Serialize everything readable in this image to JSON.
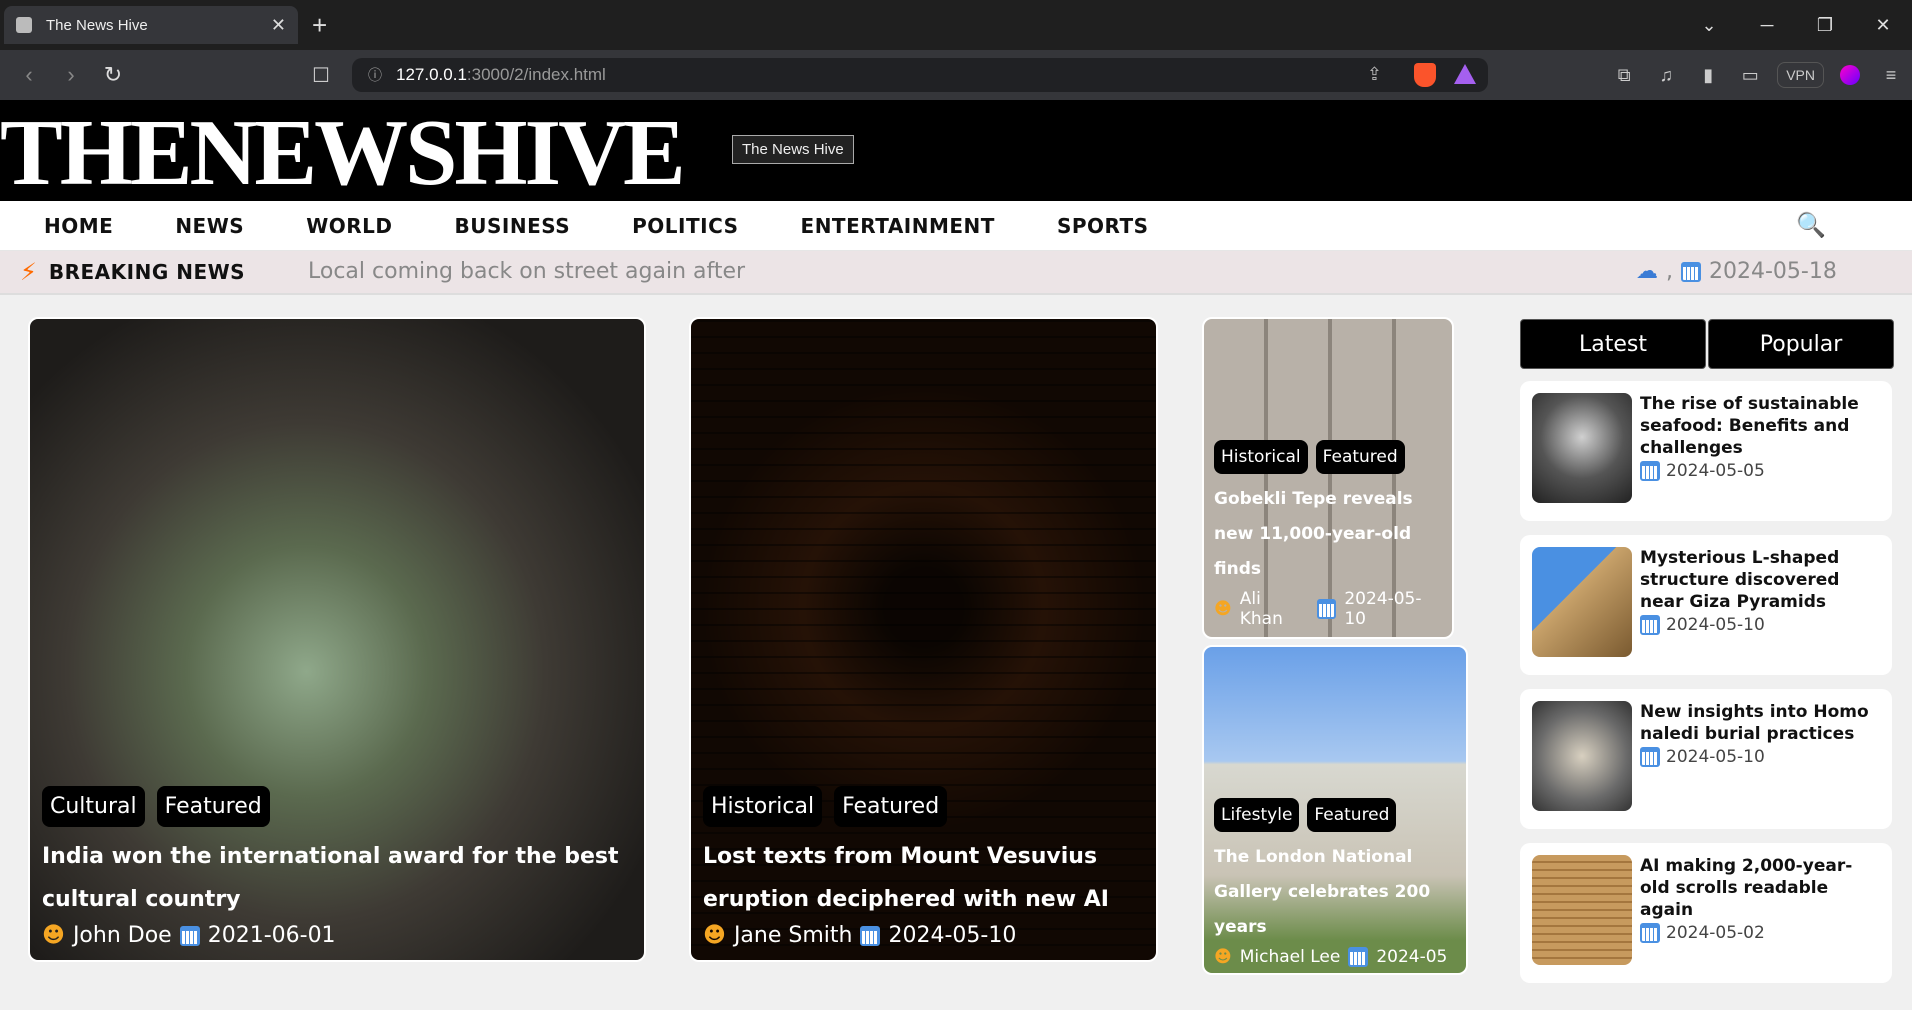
{
  "browser": {
    "tab_title": "The News Hive",
    "url_host": "127.0.0.1",
    "url_path": ":3000/2/index.html",
    "vpn_label": "VPN"
  },
  "site": {
    "logo_text": "THENEWSHIVE",
    "header_badge": "The News Hive"
  },
  "nav": {
    "items": [
      "HOME",
      "NEWS",
      "WORLD",
      "BUSINESS",
      "POLITICS",
      "ENTERTAINMENT",
      "SPORTS"
    ]
  },
  "breaking": {
    "label": "BREAKING NEWS",
    "ticker": "Local coming back on street again after",
    "weather_sep": ",",
    "date": "2024-05-18"
  },
  "featured": [
    {
      "tags": [
        "Cultural",
        "Featured"
      ],
      "title": "India won the international award for the best cultural country",
      "author": "John Doe",
      "date": "2021-06-01"
    },
    {
      "tags": [
        "Historical",
        "Featured"
      ],
      "title": "Lost texts from Mount Vesuvius eruption deciphered with new AI",
      "author": "Jane Smith",
      "date": "2024-05-10"
    },
    {
      "tags": [
        "Historical",
        "Featured"
      ],
      "title": "Gobekli Tepe reveals new 11,000-year-old finds",
      "author": "Ali Khan",
      "date": "2024-05-10"
    },
    {
      "tags": [
        "Lifestyle",
        "Featured"
      ],
      "title": "The London National Gallery celebrates 200 years",
      "author": "Michael Lee",
      "date": "2024-05"
    }
  ],
  "sidebar": {
    "tabs": [
      "Latest",
      "Popular"
    ],
    "items": [
      {
        "title": "The rise of sustainable seafood: Benefits and challenges",
        "date": "2024-05-05"
      },
      {
        "title": "Mysterious L-shaped structure discovered near Giza Pyramids",
        "date": "2024-05-10"
      },
      {
        "title": "New insights into Homo naledi burial practices",
        "date": "2024-05-10"
      },
      {
        "title": "AI making 2,000-year-old scrolls readable again",
        "date": "2024-05-02"
      }
    ]
  }
}
